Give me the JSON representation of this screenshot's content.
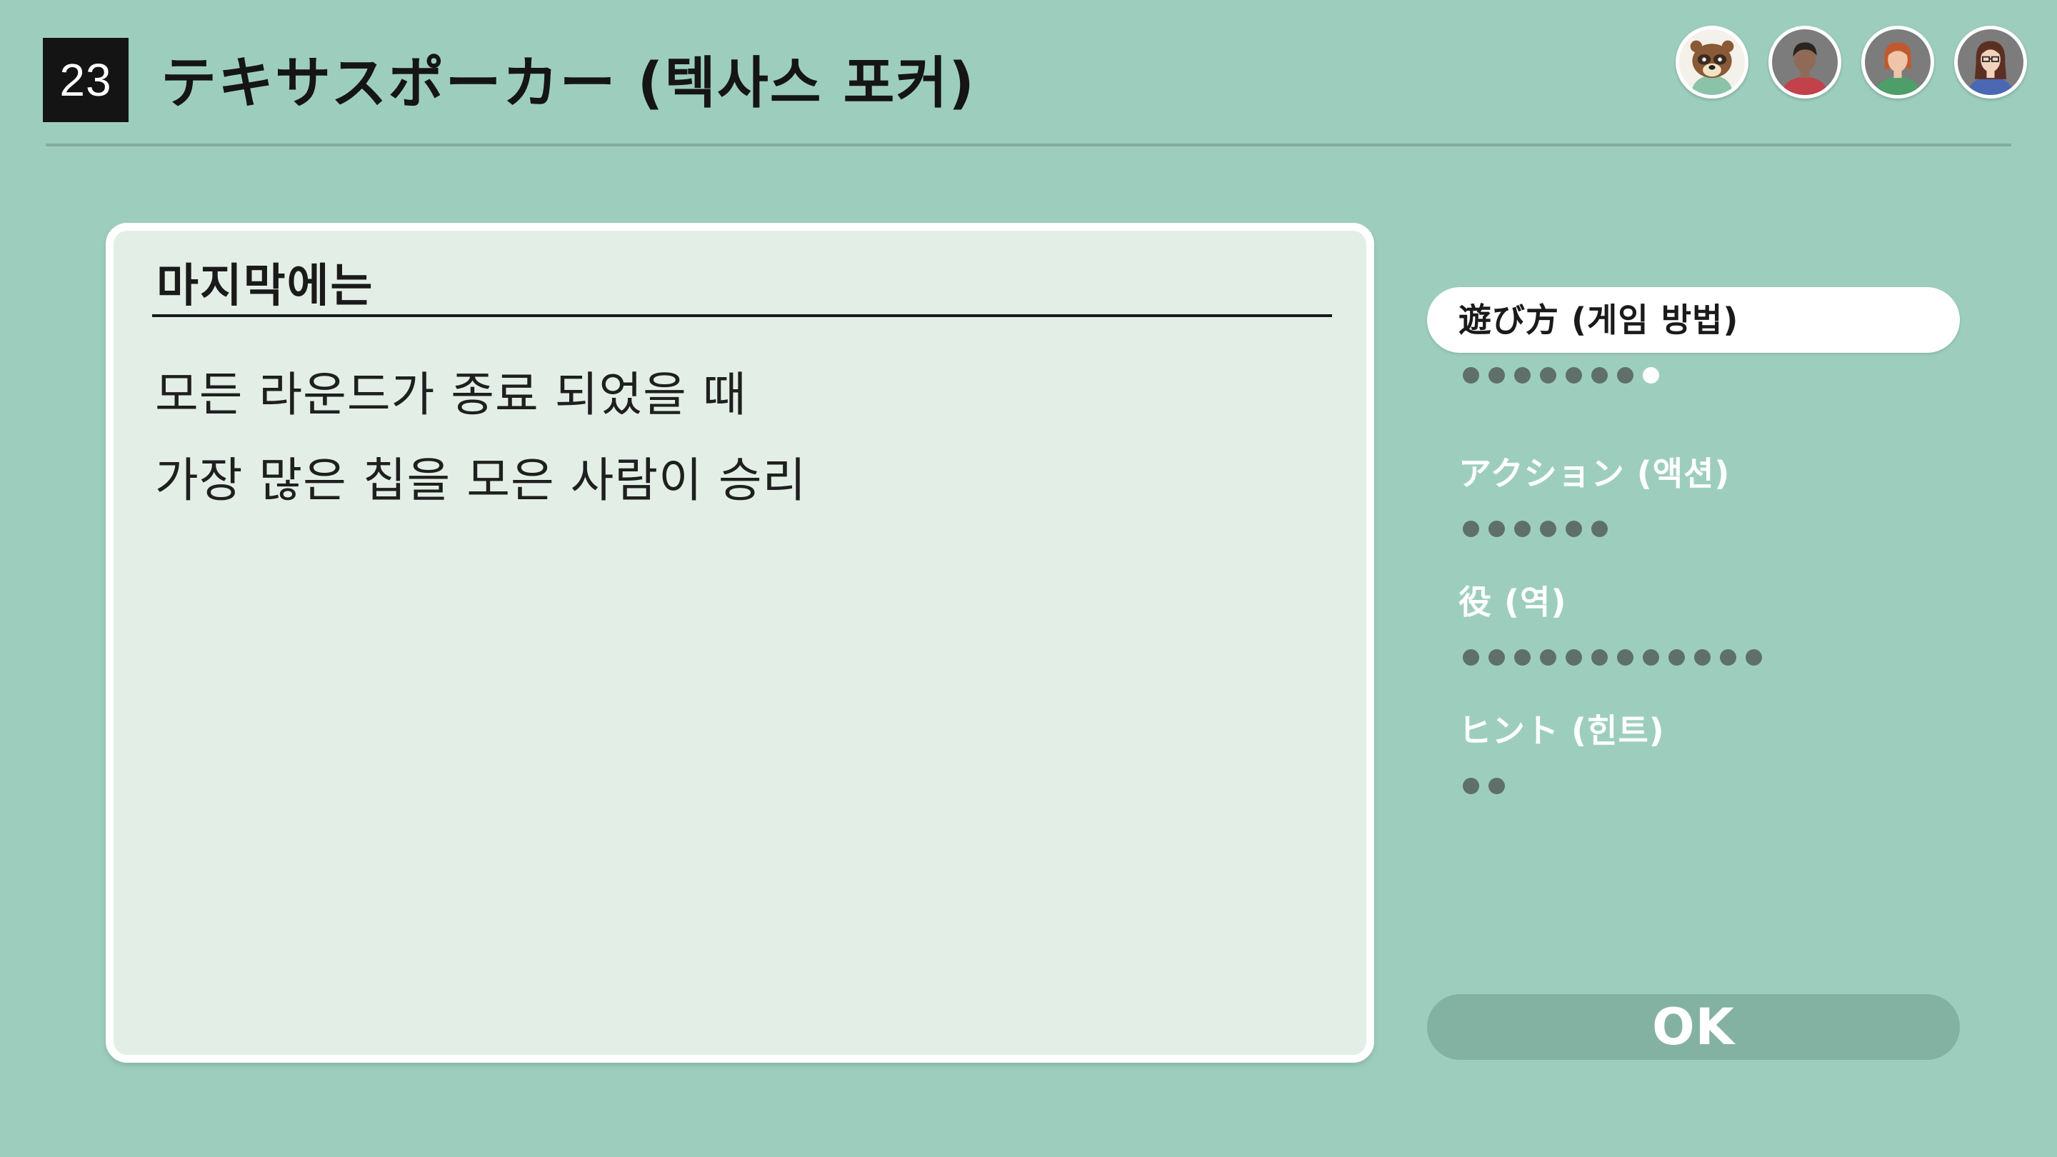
{
  "header": {
    "game_number": "23",
    "title": "テキサスポーカー (텍사스 포커)"
  },
  "players": [
    {
      "name": "tanuki-character-avatar-icon",
      "ring": "#ffffff",
      "bg": "#ffffff"
    },
    {
      "name": "player-man-avatar-icon",
      "ring": "#ffffff",
      "bg": "#7c7c7c"
    },
    {
      "name": "player-woman-red-hair-avatar-icon",
      "ring": "#ffffff",
      "bg": "#7c7c7c"
    },
    {
      "name": "player-woman-glasses-avatar-icon",
      "ring": "#ffffff",
      "bg": "#7c7c7c"
    }
  ],
  "card": {
    "heading": "마지막에는",
    "lines": [
      "모든 라운드가 종료 되었을 때",
      "가장 많은 칩을 모은 사람이 승리"
    ]
  },
  "menu": {
    "items": [
      {
        "label": "遊び方 (게임 방법)",
        "page_count": 8,
        "current_page": 8,
        "selected": true
      },
      {
        "label": "アクション (액션)",
        "page_count": 6,
        "current_page": 0,
        "selected": false
      },
      {
        "label": "役 (역)",
        "page_count": 12,
        "current_page": 0,
        "selected": false
      },
      {
        "label": "ヒント (힌트)",
        "page_count": 2,
        "current_page": 0,
        "selected": false
      }
    ]
  },
  "ok_label": "OK",
  "colors": {
    "background": "#9dcebd",
    "card": "#e3efe6",
    "selected_pill": "#ffffff",
    "ok_button": "#84b2a2",
    "dot_inactive": "#5f6f69",
    "dot_active": "#ffffff"
  }
}
